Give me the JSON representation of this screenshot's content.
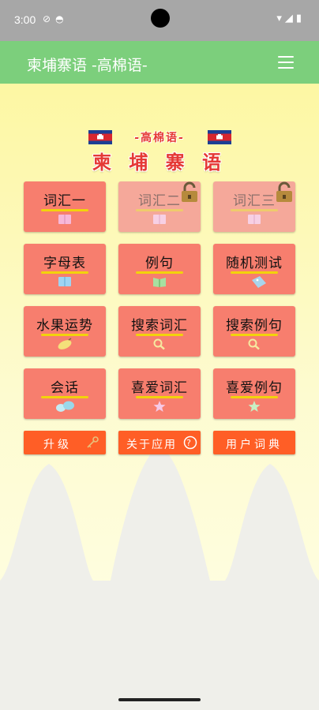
{
  "status_bar": {
    "time": "3:00",
    "left_icons": [
      "do-not-disturb-icon",
      "app-notification-icon"
    ],
    "right_icons": [
      "wifi-icon",
      "signal-icon",
      "battery-icon"
    ]
  },
  "app_bar": {
    "title": "柬埔寨语 -高棉语-",
    "menu_icon": "hamburger-menu-icon",
    "color": "#7ccf7c"
  },
  "header": {
    "subtitle": "-高棉语-",
    "title": "柬 埔 寨 语",
    "flag_icon": "cambodia-flag-icon",
    "title_color": "#e53935"
  },
  "tiles": [
    {
      "label": "词汇一",
      "icon": "book-icon",
      "locked": false
    },
    {
      "label": "词汇二",
      "icon": "book-icon",
      "locked": true
    },
    {
      "label": "词汇三",
      "icon": "book-icon",
      "locked": true
    },
    {
      "label": "字母表",
      "icon": "book-icon",
      "locked": false
    },
    {
      "label": "例句",
      "icon": "open-book-icon",
      "locked": false
    },
    {
      "label": "随机测试",
      "icon": "tag-icon",
      "locked": false
    },
    {
      "label": "水果运势",
      "icon": "fruit-icon",
      "locked": false
    },
    {
      "label": "搜索词汇",
      "icon": "magnifier-icon",
      "locked": false
    },
    {
      "label": "搜索例句",
      "icon": "magnifier-icon",
      "locked": false
    },
    {
      "label": "会话",
      "icon": "speech-bubbles-icon",
      "locked": false
    },
    {
      "label": "喜爱词汇",
      "icon": "star-icon",
      "locked": false
    },
    {
      "label": "喜爱例句",
      "icon": "star-icon",
      "locked": false
    }
  ],
  "bottom_buttons": [
    {
      "label": "升级",
      "icon": "key-icon"
    },
    {
      "label": "关于应用",
      "icon": "help-circle-icon"
    },
    {
      "label": "用户词典",
      "icon": ""
    }
  ],
  "colors": {
    "tile": "#f77e6e",
    "tile_locked": "#f5a89a",
    "underline": "#f2d30b",
    "bottom_button": "#ff5e26"
  }
}
